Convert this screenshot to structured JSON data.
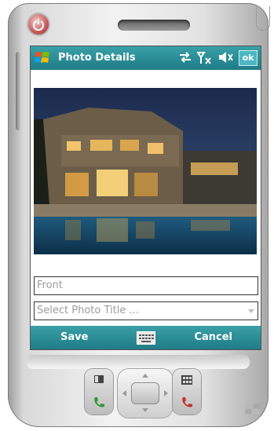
{
  "title_bar": {
    "app_title": "Photo Details",
    "ok_label": "ok"
  },
  "form": {
    "name_field_value": "Front",
    "title_dropdown_placeholder": "Select Photo Title ..."
  },
  "softkeys": {
    "left_label": "Save",
    "right_label": "Cancel"
  },
  "colors": {
    "title_bar_teal": "#2a8f99",
    "screen_bg": "#ffffff",
    "field_text_gray": "#9c9c9c"
  },
  "icons": {
    "start": "windows-logo-icon",
    "connectivity": "sync-arrows-icon",
    "signal": "no-signal-antenna-icon",
    "volume": "speaker-muted-icon",
    "keyboard": "keyboard-icon",
    "power": "power-icon",
    "call": "call-green-icon",
    "end_call": "end-call-red-icon"
  }
}
